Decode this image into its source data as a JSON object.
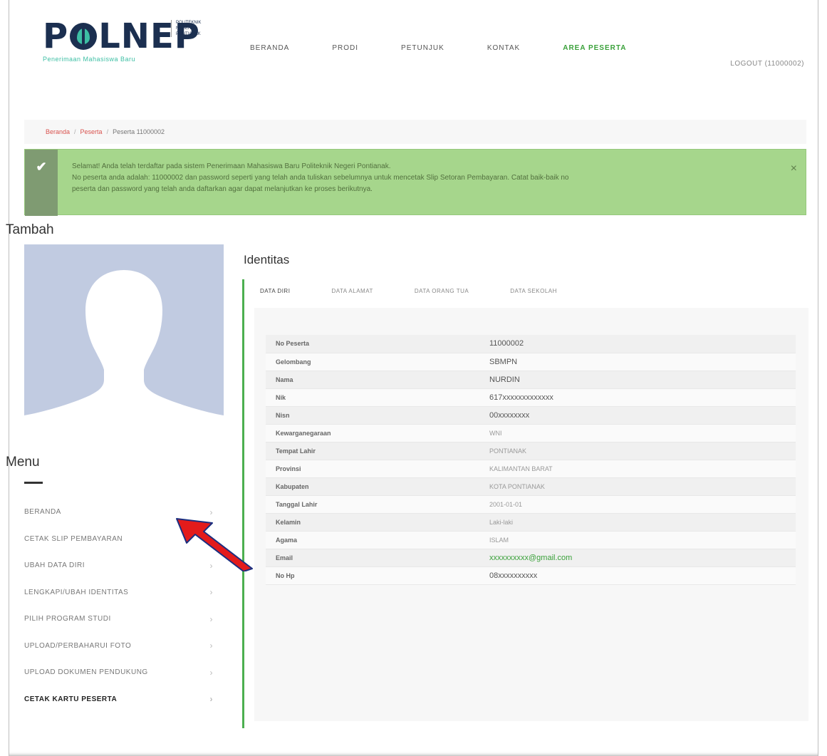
{
  "header": {
    "logo_text_p": "P",
    "logo_text_rest": "LNEP",
    "logo_tagline": "Penerimaan Mahasiswa Baru",
    "logo_institution": "POLITEKNIK NEGERI PONTIANAK",
    "nav": [
      "BERANDA",
      "PRODI",
      "PETUNJUK",
      "KONTAK",
      "AREA PESERTA"
    ],
    "logout": "LOGOUT (11000002)"
  },
  "breadcrumb": [
    "Beranda",
    "Peserta",
    "Peserta 11000002"
  ],
  "alert": {
    "line1": "Selamat! Anda telah terdaftar pada sistem Penerimaan Mahasiswa Baru Politeknik Negeri Pontianak.",
    "line2": "No peserta anda adalah: 11000002 dan password seperti yang telah anda tuliskan sebelumnya untuk mencetak Slip Setoran Pembayaran. Catat baik-baik no",
    "line3": "peserta dan password yang telah anda daftarkan agar dapat melanjutkan ke proses berikutnya.",
    "close": "×"
  },
  "tambah": "Tambah",
  "menu": {
    "title": "Menu",
    "items": [
      "BERANDA",
      "CETAK SLIP PEMBAYARAN",
      "UBAH DATA DIRI",
      "LENGKAPI/UBAH IDENTITAS",
      "PILIH PROGRAM STUDI",
      "UPLOAD/PERBAHARUI FOTO",
      "UPLOAD DOKUMEN PENDUKUNG",
      "CETAK KARTU PESERTA"
    ]
  },
  "identitas": {
    "title": "Identitas",
    "tabs": [
      "DATA DIRI",
      "DATA ALAMAT",
      "DATA ORANG TUA",
      "DATA SEKOLAH"
    ],
    "rows": [
      {
        "label": "No Peserta",
        "value": "11000002"
      },
      {
        "label": "Gelombang",
        "value": "SBMPN"
      },
      {
        "label": "Nama",
        "value": "NURDIN"
      },
      {
        "label": "Nik",
        "value": "617xxxxxxxxxxxxx"
      },
      {
        "label": "Nisn",
        "value": "00xxxxxxxx"
      },
      {
        "label": "Kewarganegaraan",
        "value": "WNI"
      },
      {
        "label": "Tempat Lahir",
        "value": "PONTIANAK"
      },
      {
        "label": "Provinsi",
        "value": "KALIMANTAN BARAT"
      },
      {
        "label": "Kabupaten",
        "value": "KOTA PONTIANAK"
      },
      {
        "label": "Tanggal Lahir",
        "value": "2001-01-01"
      },
      {
        "label": "Kelamin",
        "value": "Laki-laki"
      },
      {
        "label": "Agama",
        "value": "ISLAM"
      },
      {
        "label": "Email",
        "value": "xxxxxxxxxx@gmail.com"
      },
      {
        "label": "No Hp",
        "value": "08xxxxxxxxxx"
      }
    ]
  },
  "colors": {
    "accent_green": "#3aa13a",
    "alert_bg": "#a6d68c",
    "arrow_red": "#e31b1b",
    "avatar_bg": "#c1cbe1"
  }
}
